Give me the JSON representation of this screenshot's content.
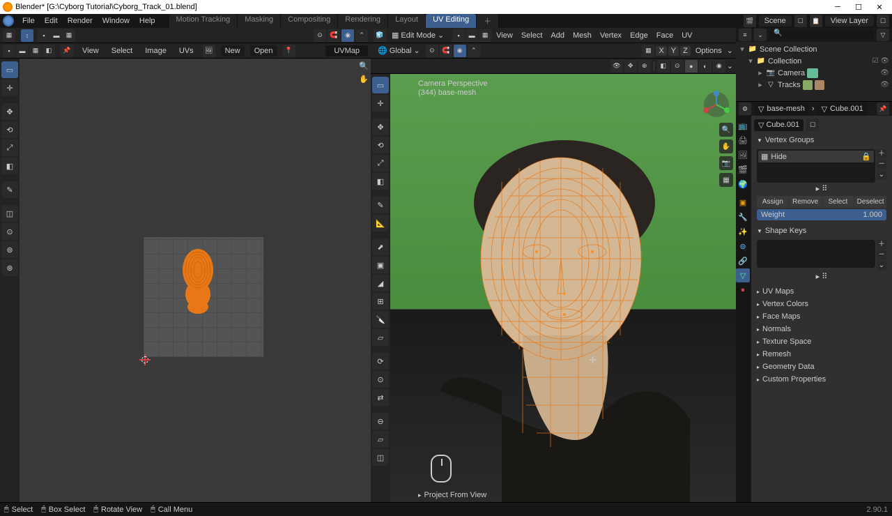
{
  "window_title": "Blender* [G:\\Cyborg Tutorial\\Cyborg_Track_01.blend]",
  "menu": {
    "file": "File",
    "edit": "Edit",
    "render": "Render",
    "window": "Window",
    "help": "Help"
  },
  "workspaces": [
    "Motion Tracking",
    "Masking",
    "Compositing",
    "Rendering",
    "Layout",
    "UV Editing"
  ],
  "scene_label": "Scene",
  "viewlayer_label": "View Layer",
  "uv": {
    "menus": {
      "view": "View",
      "select": "Select",
      "image": "Image",
      "uv": "UVs"
    },
    "new": "New",
    "open": "Open",
    "uvmap": "UVMap"
  },
  "vp": {
    "mode": "Edit Mode",
    "orient": "Global",
    "options": "Options",
    "menus": {
      "view": "View",
      "select": "Select",
      "add": "Add",
      "mesh": "Mesh",
      "vertex": "Vertex",
      "edge": "Edge",
      "face": "Face",
      "uv": "UV"
    },
    "info1": "Camera Perspective",
    "info2": "(344) base-mesh",
    "last_op": "Project From View"
  },
  "outliner": {
    "root": "Scene Collection",
    "coll": "Collection",
    "cam": "Camera",
    "tracks": "Tracks"
  },
  "props": {
    "obj": "base-mesh",
    "mesh": "Cube.001",
    "mesh2": "Cube.001",
    "sections": {
      "vg": "Vertex Groups",
      "sk": "Shape Keys",
      "uv": "UV Maps",
      "vc": "Vertex Colors",
      "fm": "Face Maps",
      "nm": "Normals",
      "ts": "Texture Space",
      "rm": "Remesh",
      "gd": "Geometry Data",
      "cp": "Custom Properties"
    },
    "vg_item": "Hide",
    "btns": {
      "assign": "Assign",
      "remove": "Remove",
      "select": "Select",
      "deselect": "Deselect"
    },
    "weight_label": "Weight",
    "weight_val": "1.000"
  },
  "status": {
    "select": "Select",
    "box": "Box Select",
    "rotate": "Rotate View",
    "menu": "Call Menu",
    "version": "2.90.1"
  }
}
